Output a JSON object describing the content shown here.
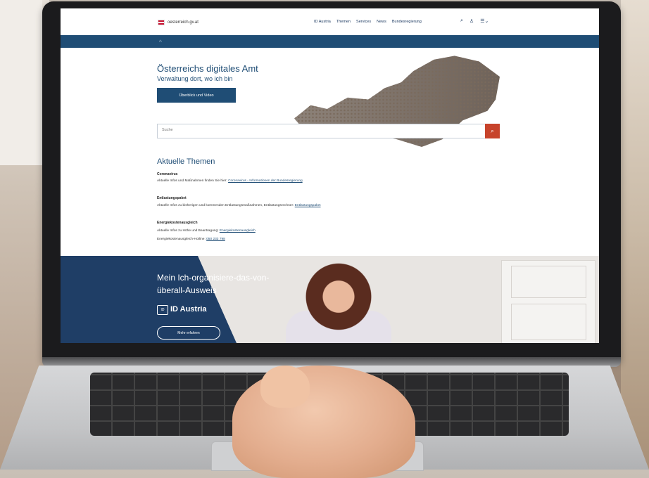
{
  "site": {
    "logo_text": "oesterreich.gv.at",
    "nav": [
      "ID Austria",
      "Themen",
      "Services",
      "News",
      "Bundesregierung"
    ],
    "icons": [
      "search-icon",
      "user-icon",
      "menu-icon"
    ]
  },
  "hero": {
    "title": "Österreichs digitales Amt",
    "subtitle": "Verwaltung dort, wo ich bin",
    "button": "Überblick und Video",
    "search_placeholder": "Suche"
  },
  "topics": {
    "title": "Aktuelle Themen",
    "items": [
      {
        "heading": "Coronavirus",
        "text": "Aktuelle Infos und Maßnahmen finden Sie hier:",
        "link": "Coronavirus - Informationen der Bundesregierung"
      },
      {
        "heading": "Entlastungspaket",
        "text": "Aktuelle Infos zu bisherigen und kommenden Entlastungsmaßnahmen, Entlastungsrechner:",
        "link": "Entlastungspaket"
      },
      {
        "heading": "Energiekostenausgleich",
        "text": "Aktuelle Infos zu Höhe und Beantragung:",
        "link": "Energiekostenausgleich",
        "text2": "Energiekostenausgleich-Hotline:",
        "link2": "050 233 798"
      }
    ]
  },
  "promo": {
    "title": "Mein Ich-organisiere-das-von-überall-Ausweis",
    "logo": "ID Austria",
    "button": "Mehr erfahren"
  },
  "colors": {
    "brand_blue": "#1f4d75",
    "search_button_red": "#c7432b"
  }
}
